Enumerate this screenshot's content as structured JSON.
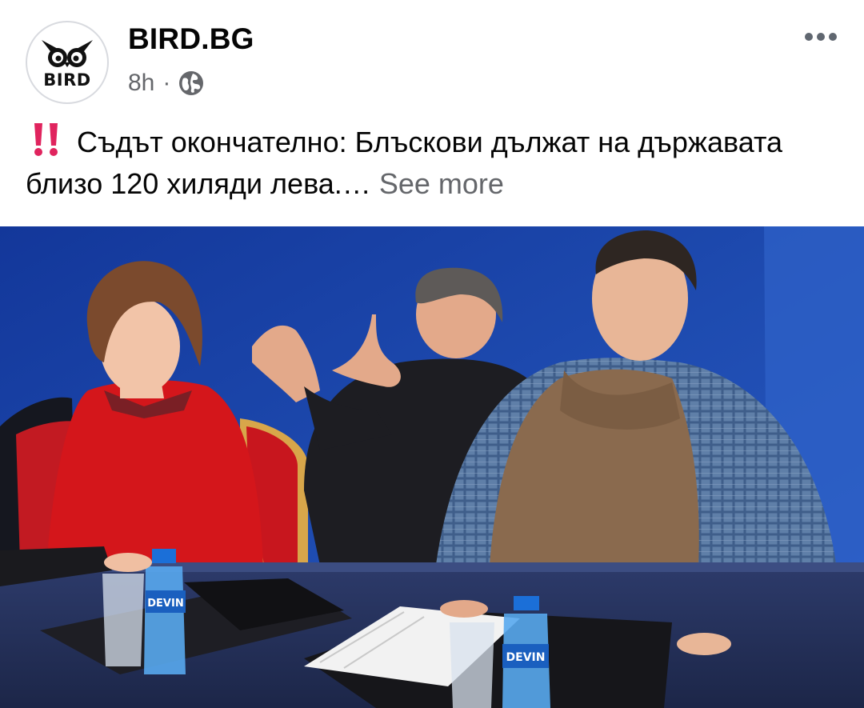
{
  "post": {
    "page_name": "BIRD.BG",
    "avatar_text": "BIRD",
    "time": "8h",
    "separator": "·",
    "audience_icon": "globe-icon",
    "more_icon": "more-horizontal-icon",
    "caption_emoji": "double-exclamation-icon",
    "caption_text": "Съдът окончателно: Блъскови дължат на държавата близо 120 хиляди лева.…",
    "see_more": "See more",
    "photo": {
      "description_icon": "photo",
      "bottle_brand": "DEVIN"
    }
  },
  "colors": {
    "text_primary": "#050505",
    "text_secondary": "#65676b",
    "emoji_red": "#e0245e",
    "photo_background": "#1c47a8"
  }
}
